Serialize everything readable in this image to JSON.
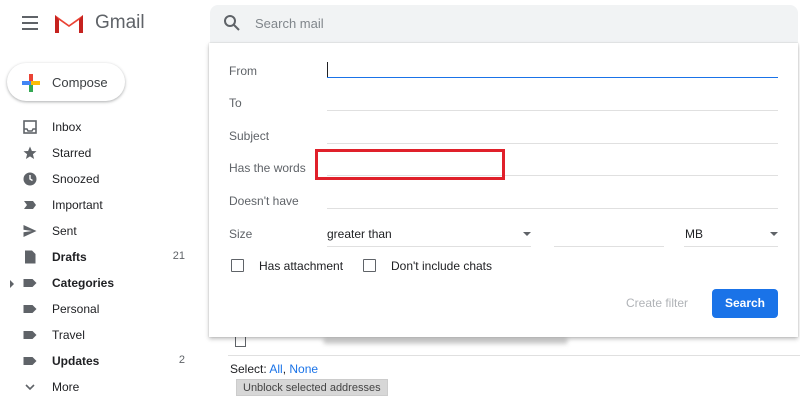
{
  "header": {
    "brand": "Gmail",
    "search_placeholder": "Search mail"
  },
  "sidebar": {
    "compose_label": "Compose",
    "items": [
      {
        "label": "Inbox",
        "count": "",
        "bold": false,
        "icon": "inbox-icon"
      },
      {
        "label": "Starred",
        "count": "",
        "bold": false,
        "icon": "star-icon"
      },
      {
        "label": "Snoozed",
        "count": "",
        "bold": false,
        "icon": "clock-icon"
      },
      {
        "label": "Important",
        "count": "",
        "bold": false,
        "icon": "important-icon"
      },
      {
        "label": "Sent",
        "count": "",
        "bold": false,
        "icon": "send-icon"
      },
      {
        "label": "Drafts",
        "count": "21",
        "bold": true,
        "icon": "draft-icon"
      },
      {
        "label": "Categories",
        "count": "",
        "bold": true,
        "icon": "label-icon"
      },
      {
        "label": "Personal",
        "count": "",
        "bold": false,
        "icon": "label-icon"
      },
      {
        "label": "Travel",
        "count": "",
        "bold": false,
        "icon": "label-icon"
      },
      {
        "label": "Updates",
        "count": "2",
        "bold": true,
        "icon": "label-icon"
      },
      {
        "label": "More",
        "count": "",
        "bold": false,
        "icon": "chevron-down-icon"
      }
    ]
  },
  "filter": {
    "from_label": "From",
    "to_label": "To",
    "subject_label": "Subject",
    "has_words_label": "Has the words",
    "doesnt_have_label": "Doesn't have",
    "size_label": "Size",
    "size_operator": "greater than",
    "size_unit": "MB",
    "has_attachment_label": "Has attachment",
    "dont_include_chats_label": "Don't include chats",
    "create_filter_label": "Create filter",
    "search_button_label": "Search"
  },
  "background": {
    "select_prefix": "Select:",
    "select_all": "All",
    "select_none": "None",
    "unblock_label": "Unblock selected addresses"
  },
  "colors": {
    "accent": "#1a73e8",
    "highlight": "#e0202a"
  }
}
